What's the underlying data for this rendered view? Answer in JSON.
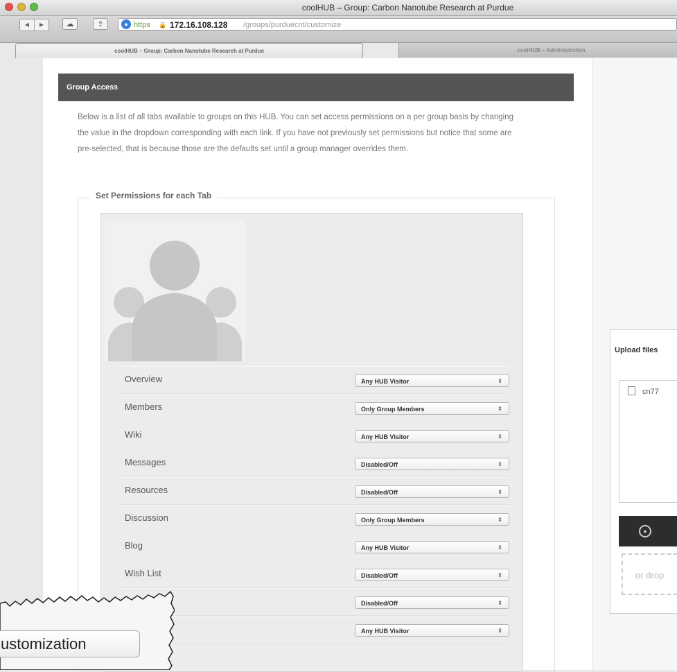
{
  "window": {
    "title": "coolHUB – Group: Carbon Nanotube Research at Purdue"
  },
  "address_bar": {
    "scheme": "https",
    "host": "172.16.108.128",
    "path": "/groups/purduecnt/customize"
  },
  "tabs": [
    {
      "label": "coolHUB – Group: Carbon Nanotube Research at Purdue",
      "active": true
    },
    {
      "label": "coolHUB – Administration",
      "active": false
    }
  ],
  "group_access": {
    "header": "Group Access",
    "description": "Below is a list of all tabs available to groups on this HUB. You can set access permissions on a per group basis by changing the value in the dropdown corresponding with each link. If you have not previously set permissions but notice that some are pre-selected, that is because those are the defaults set until a group manager overrides them.",
    "fieldset_legend": "Set Permissions for each Tab",
    "rows": [
      {
        "label": "Overview",
        "value": "Any HUB Visitor"
      },
      {
        "label": "Members",
        "value": "Only Group Members"
      },
      {
        "label": "Wiki",
        "value": "Any HUB Visitor"
      },
      {
        "label": "Messages",
        "value": "Disabled/Off"
      },
      {
        "label": "Resources",
        "value": "Disabled/Off"
      },
      {
        "label": "Discussion",
        "value": "Only Group Members"
      },
      {
        "label": "Blog",
        "value": "Any HUB Visitor"
      },
      {
        "label": "Wish List",
        "value": "Disabled/Off"
      },
      {
        "label": "",
        "value": "Disabled/Off"
      },
      {
        "label": "",
        "value": "Any HUB Visitor"
      }
    ]
  },
  "upload": {
    "title": "Upload files",
    "file_name": "cn77",
    "drop_text": "or drop"
  },
  "zoom_callout": {
    "button_label": "ustomization"
  }
}
